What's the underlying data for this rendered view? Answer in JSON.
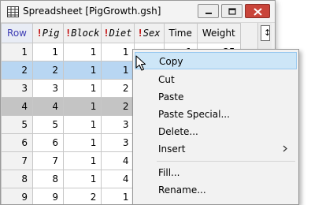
{
  "window": {
    "title": "Spreadsheet [PigGrowth.gsh]"
  },
  "grid": {
    "columns": [
      {
        "label": "Row",
        "kind": "row"
      },
      {
        "label": "Pig",
        "kind": "factor"
      },
      {
        "label": "Block",
        "kind": "factor"
      },
      {
        "label": "Diet",
        "kind": "factor"
      },
      {
        "label": "Sex",
        "kind": "factor"
      },
      {
        "label": "Time",
        "kind": "plain"
      },
      {
        "label": "Weight",
        "kind": "plain"
      }
    ],
    "factor_marker": "!",
    "rows": [
      {
        "row": "1",
        "pig": "1",
        "block": "1",
        "diet": "1",
        "sex": "",
        "time": "1",
        "weight": "25"
      },
      {
        "row": "2",
        "pig": "2",
        "block": "1",
        "diet": "1",
        "sex": "",
        "time": "",
        "weight": ""
      },
      {
        "row": "3",
        "pig": "3",
        "block": "1",
        "diet": "2",
        "sex": "",
        "time": "",
        "weight": ""
      },
      {
        "row": "4",
        "pig": "4",
        "block": "1",
        "diet": "2",
        "sex": "",
        "time": "",
        "weight": ""
      },
      {
        "row": "5",
        "pig": "5",
        "block": "1",
        "diet": "3",
        "sex": "",
        "time": "",
        "weight": ""
      },
      {
        "row": "6",
        "pig": "6",
        "block": "1",
        "diet": "3",
        "sex": "",
        "time": "",
        "weight": ""
      },
      {
        "row": "7",
        "pig": "7",
        "block": "1",
        "diet": "4",
        "sex": "",
        "time": "",
        "weight": ""
      },
      {
        "row": "8",
        "pig": "8",
        "block": "1",
        "diet": "4",
        "sex": "",
        "time": "",
        "weight": ""
      },
      {
        "row": "9",
        "pig": "9",
        "block": "2",
        "diet": "1",
        "sex": "",
        "time": "",
        "weight": ""
      }
    ]
  },
  "context_menu": {
    "items": [
      {
        "label": "Copy"
      },
      {
        "label": "Cut"
      },
      {
        "label": "Paste"
      },
      {
        "label": "Paste Special..."
      },
      {
        "label": "Delete..."
      },
      {
        "label": "Insert"
      },
      {
        "label": "Fill..."
      },
      {
        "label": "Rename..."
      }
    ]
  },
  "colors": {
    "selected_row": "#b8d6f2",
    "gray_row": "#c4c4c4",
    "menu_highlight": "#cde6f7",
    "factor_marker": "#c00000",
    "close_button": "#c9443a"
  },
  "icons": {
    "app": "spreadsheet-icon",
    "minimize": "minimize-icon",
    "maximize": "maximize-icon",
    "close": "close-icon",
    "submenu": "chevron-right-icon",
    "cursor": "mouse-pointer-icon"
  }
}
